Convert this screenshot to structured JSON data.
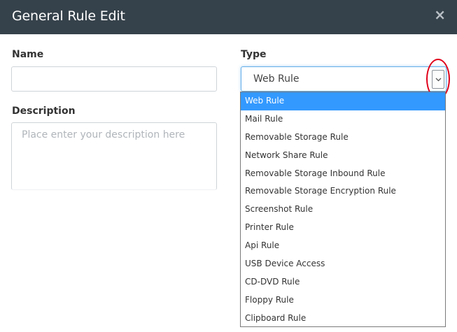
{
  "dialog": {
    "title": "General Rule Edit",
    "close_glyph": "×"
  },
  "form": {
    "name_label": "Name",
    "name_value": "",
    "description_label": "Description",
    "description_placeholder": "Place enter your description here",
    "type_label": "Type",
    "type_selected": "Web Rule"
  },
  "dropdown": {
    "options": [
      "Web Rule",
      "Mail Rule",
      "Removable Storage Rule",
      "Network Share Rule",
      "Removable Storage Inbound Rule",
      "Removable Storage Encryption Rule",
      "Screenshot Rule",
      "Printer Rule",
      "Api Rule",
      "USB Device Access",
      "CD-DVD Rule",
      "Floppy Rule",
      "Clipboard Rule"
    ],
    "selected_index": 0
  },
  "colors": {
    "header_bg": "#36424b",
    "selected_option_bg": "#3399ff",
    "annotation_ring": "#e0001b"
  }
}
